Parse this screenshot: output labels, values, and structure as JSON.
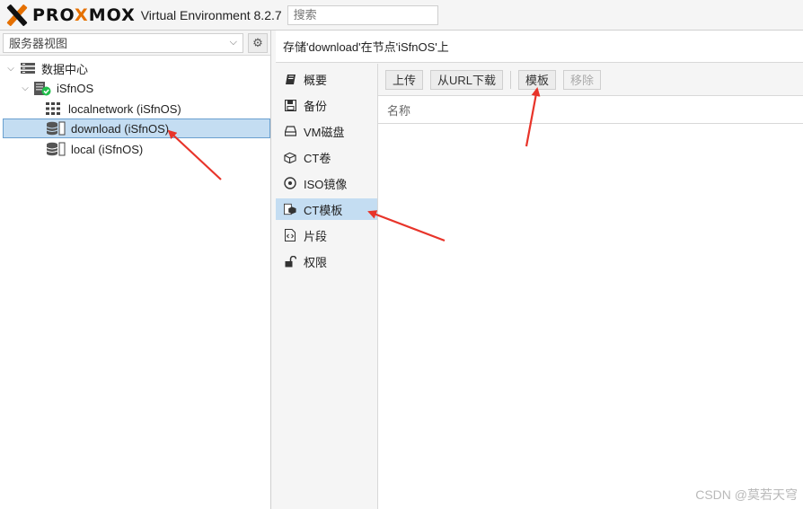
{
  "header": {
    "logo_prefix": "PRO",
    "logo_accent": "X",
    "logo_suffix": "MOX",
    "product": "Virtual Environment 8.2.7",
    "search_placeholder": "搜索"
  },
  "left": {
    "view_select": "服务器视图",
    "tree": [
      {
        "label": "数据中心",
        "icon": "datacenter-icon"
      },
      {
        "label": "iSfnOS",
        "icon": "node-online-icon"
      },
      {
        "label": "localnetwork (iSfnOS)",
        "icon": "network-grid-icon"
      },
      {
        "label": "download (iSfnOS)",
        "icon": "storage-icon",
        "selected": true
      },
      {
        "label": "local (iSfnOS)",
        "icon": "storage-icon"
      }
    ]
  },
  "right": {
    "title": "存储'download'在节点'iSfnOS'上",
    "submenu": [
      {
        "label": "概要",
        "icon": "book-icon"
      },
      {
        "label": "备份",
        "icon": "floppy-icon"
      },
      {
        "label": "VM磁盘",
        "icon": "hdd-icon"
      },
      {
        "label": "CT卷",
        "icon": "cube-icon"
      },
      {
        "label": "ISO镜像",
        "icon": "disc-icon"
      },
      {
        "label": "CT模板",
        "icon": "cube-file-icon",
        "active": true
      },
      {
        "label": "片段",
        "icon": "code-file-icon"
      },
      {
        "label": "权限",
        "icon": "unlock-icon"
      }
    ],
    "toolbar": {
      "upload": "上传",
      "download_url": "从URL下载",
      "templates": "模板",
      "remove": "移除"
    },
    "grid_header": "名称"
  },
  "watermark": "CSDN @莫若天穹",
  "colors": {
    "accent": "#e57000",
    "selection": "#c4ddf2",
    "arrow": "#e8342a",
    "online": "#21bf4b"
  }
}
